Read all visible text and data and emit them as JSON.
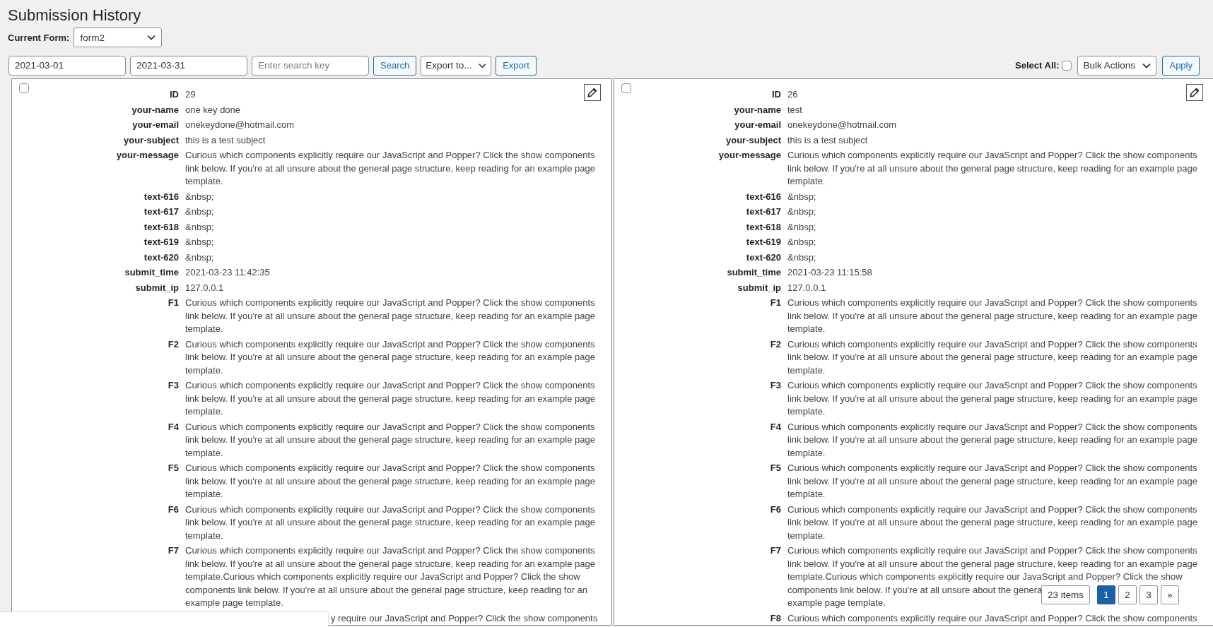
{
  "title": "Submission History",
  "current_form": {
    "label": "Current Form:",
    "value": "form2"
  },
  "filters": {
    "date_from": "2021-03-01",
    "date_to": "2021-03-31",
    "search_placeholder": "Enter search key",
    "search_button": "Search",
    "export_select": "Export to...",
    "export_button": "Export"
  },
  "bulk": {
    "select_all_label": "Select All:",
    "select_all_checked": false,
    "actions": "Bulk Actions",
    "apply": "Apply"
  },
  "cards": [
    {
      "checked": false,
      "fields": [
        {
          "label": "ID",
          "value": "29"
        },
        {
          "label": "your-name",
          "value": "one key done"
        },
        {
          "label": "your-email",
          "value": "onekeydone@hotmail.com"
        },
        {
          "label": "your-subject",
          "value": "this is a test subject"
        },
        {
          "label": "your-message",
          "value": "Curious which components explicitly require our JavaScript and Popper? Click the show components link below. If you're at all unsure about the general page structure, keep reading for an example page template."
        },
        {
          "label": "text-616",
          "value": "&nbsp;"
        },
        {
          "label": "text-617",
          "value": "&nbsp;"
        },
        {
          "label": "text-618",
          "value": "&nbsp;"
        },
        {
          "label": "text-619",
          "value": "&nbsp;"
        },
        {
          "label": "text-620",
          "value": "&nbsp;"
        },
        {
          "label": "submit_time",
          "value": "2021-03-23 11:42:35"
        },
        {
          "label": "submit_ip",
          "value": "127.0.0.1"
        },
        {
          "label": "F1",
          "value": "Curious which components explicitly require our JavaScript and Popper? Click the show components link below. If you're at all unsure about the general page structure, keep reading for an example page template."
        },
        {
          "label": "F2",
          "value": "Curious which components explicitly require our JavaScript and Popper? Click the show components link below. If you're at all unsure about the general page structure, keep reading for an example page template."
        },
        {
          "label": "F3",
          "value": "Curious which components explicitly require our JavaScript and Popper? Click the show components link below. If you're at all unsure about the general page structure, keep reading for an example page template."
        },
        {
          "label": "F4",
          "value": "Curious which components explicitly require our JavaScript and Popper? Click the show components link below. If you're at all unsure about the general page structure, keep reading for an example page template."
        },
        {
          "label": "F5",
          "value": "Curious which components explicitly require our JavaScript and Popper? Click the show components link below. If you're at all unsure about the general page structure, keep reading for an example page template."
        },
        {
          "label": "F6",
          "value": "Curious which components explicitly require our JavaScript and Popper? Click the show components link below. If you're at all unsure about the general page structure, keep reading for an example page template."
        },
        {
          "label": "F7",
          "value": "Curious which components explicitly require our JavaScript and Popper? Click the show components link below. If you're at all unsure about the general page structure, keep reading for an example page template.Curious which components explicitly require our JavaScript and Popper? Click the show components link below. If you're at all unsure about the general page structure, keep reading for an example page template."
        }
      ],
      "cut_value": "y require our JavaScript and Popper? Click the show components"
    },
    {
      "checked": false,
      "fields": [
        {
          "label": "ID",
          "value": "26"
        },
        {
          "label": "your-name",
          "value": "test"
        },
        {
          "label": "your-email",
          "value": "onekeydone@hotmail.com"
        },
        {
          "label": "your-subject",
          "value": "this is a test subject"
        },
        {
          "label": "your-message",
          "value": "Curious which components explicitly require our JavaScript and Popper? Click the show components link below. If you're at all unsure about the general page structure, keep reading for an example page template."
        },
        {
          "label": "text-616",
          "value": "&nbsp;"
        },
        {
          "label": "text-617",
          "value": "&nbsp;"
        },
        {
          "label": "text-618",
          "value": "&nbsp;"
        },
        {
          "label": "text-619",
          "value": "&nbsp;"
        },
        {
          "label": "text-620",
          "value": "&nbsp;"
        },
        {
          "label": "submit_time",
          "value": "2021-03-23 11:15:58"
        },
        {
          "label": "submit_ip",
          "value": "127.0.0.1"
        },
        {
          "label": "F1",
          "value": "Curious which components explicitly require our JavaScript and Popper? Click the show components link below. If you're at all unsure about the general page structure, keep reading for an example page template."
        },
        {
          "label": "F2",
          "value": "Curious which components explicitly require our JavaScript and Popper? Click the show components link below. If you're at all unsure about the general page structure, keep reading for an example page template."
        },
        {
          "label": "F3",
          "value": "Curious which components explicitly require our JavaScript and Popper? Click the show components link below. If you're at all unsure about the general page structure, keep reading for an example page template."
        },
        {
          "label": "F4",
          "value": "Curious which components explicitly require our JavaScript and Popper? Click the show components link below. If you're at all unsure about the general page structure, keep reading for an example page template."
        },
        {
          "label": "F5",
          "value": "Curious which components explicitly require our JavaScript and Popper? Click the show components link below. If you're at all unsure about the general page structure, keep reading for an example page template."
        },
        {
          "label": "F6",
          "value": "Curious which components explicitly require our JavaScript and Popper? Click the show components link below. If you're at all unsure about the general page structure, keep reading for an example page template."
        },
        {
          "label": "F7",
          "value": "Curious which components explicitly require our JavaScript and Popper? Click the show components link below. If you're at all unsure about the general page structure, keep reading for an example page template.Curious which components explicitly require our JavaScript and Popper? Click the show",
          "value_parts": [
            "components link below. If you're at all unsure about the genera",
            "example page template."
          ]
        },
        {
          "label": "F8",
          "value": "Curious which components explicitly require our JavaScript and Popper? Click the show components"
        }
      ]
    }
  ],
  "pagination": {
    "count": "23 items",
    "pages": [
      {
        "label": "1",
        "selected": true
      },
      {
        "label": "2",
        "selected": false
      },
      {
        "label": "3",
        "selected": false
      }
    ],
    "next": "»"
  }
}
